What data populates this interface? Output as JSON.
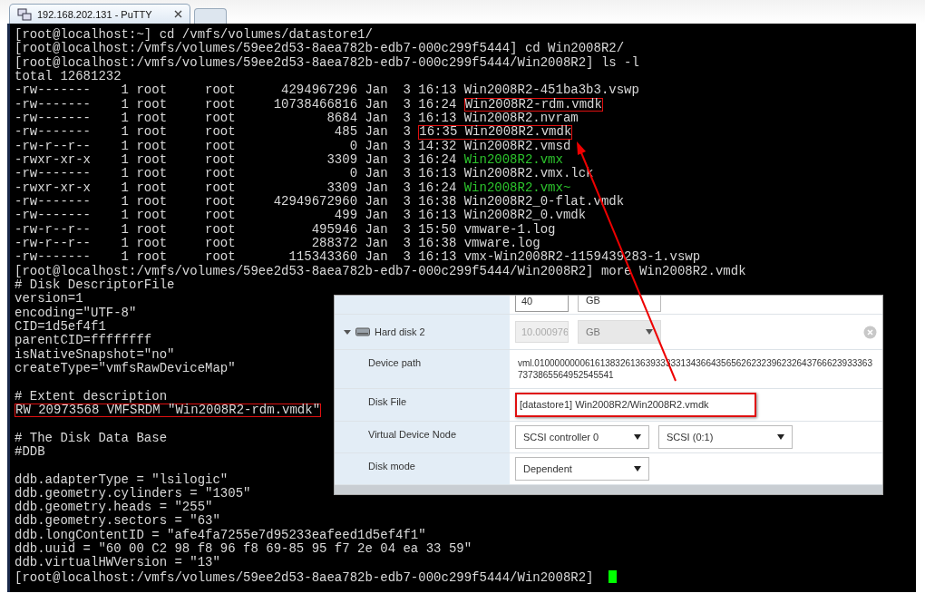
{
  "window": {
    "title": "192.168.202.131 - PuTTY"
  },
  "terminal": {
    "blocks": [
      {
        "lines": [
          {
            "parts": [
              {
                "text": "[root@localhost:~] cd /vmfs/volumes/datastore1/",
                "kind": "plain",
                "highlighted": false
              }
            ]
          },
          {
            "parts": [
              {
                "text": "[root@localhost:/vmfs/volumes/59ee2d53-8aea782b-edb7-000c299f5444] cd Win2008R2/",
                "kind": "plain",
                "highlighted": false
              }
            ]
          },
          {
            "parts": [
              {
                "text": "[root@localhost:/vmfs/volumes/59ee2d53-8aea782b-edb7-000c299f5444/Win2008R2] ls -l",
                "kind": "plain",
                "highlighted": false
              }
            ]
          },
          {
            "parts": [
              {
                "text": "total 12681232",
                "kind": "plain",
                "highlighted": false
              }
            ]
          },
          {
            "parts": [
              {
                "text": "-rw-------    1 root     root      4294967296 Jan  3 16:13 Win2008R2-451ba3b3.vswp",
                "kind": "plain",
                "highlighted": false
              }
            ]
          },
          {
            "parts": [
              {
                "text": "-rw-------    1 root     root     10738466816 Jan  3 16:24 ",
                "kind": "plain",
                "highlighted": false
              },
              {
                "text": "Win2008R2-rdm.vmdk",
                "kind": "plain",
                "highlighted": true
              }
            ]
          },
          {
            "parts": [
              {
                "text": "-rw-------    1 root     root            8684 Jan  3 16:13 Win2008R2.nvram",
                "kind": "plain",
                "highlighted": false
              }
            ]
          },
          {
            "parts": [
              {
                "text": "-rw-------    1 root     root             485 Jan  3 ",
                "kind": "plain",
                "highlighted": false
              },
              {
                "text": "16:35 Win2008R2.vmdk",
                "kind": "plain",
                "highlighted": true
              }
            ]
          },
          {
            "parts": [
              {
                "text": "-rw-r--r--    1 root     root               0 Jan  3 14:32 Win2008R2.vmsd",
                "kind": "plain",
                "highlighted": false
              }
            ]
          },
          {
            "parts": [
              {
                "text": "-rwxr-xr-x    1 root     root            3309 Jan  3 16:24 ",
                "kind": "plain",
                "highlighted": false
              },
              {
                "text": "Win2008R2.vmx",
                "kind": "executable",
                "highlighted": false
              }
            ]
          },
          {
            "parts": [
              {
                "text": "-rw-------    1 root     root               0 Jan  3 16:13 Win2008R2.vmx.lck",
                "kind": "plain",
                "highlighted": false
              }
            ]
          },
          {
            "parts": [
              {
                "text": "-rwxr-xr-x    1 root     root            3309 Jan  3 16:24 ",
                "kind": "plain",
                "highlighted": false
              },
              {
                "text": "Win2008R2.vmx~",
                "kind": "executable",
                "highlighted": false
              }
            ]
          },
          {
            "parts": [
              {
                "text": "-rw-------    1 root     root     42949672960 Jan  3 16:38 Win2008R2_0-flat.vmdk",
                "kind": "plain",
                "highlighted": false
              }
            ]
          },
          {
            "parts": [
              {
                "text": "-rw-------    1 root     root             499 Jan  3 16:13 Win2008R2_0.vmdk",
                "kind": "plain",
                "highlighted": false
              }
            ]
          },
          {
            "parts": [
              {
                "text": "-rw-r--r--    1 root     root          495946 Jan  3 15:50 vmware-1.log",
                "kind": "plain",
                "highlighted": false
              }
            ]
          },
          {
            "parts": [
              {
                "text": "-rw-r--r--    1 root     root          288372 Jan  3 16:38 vmware.log",
                "kind": "plain",
                "highlighted": false
              }
            ]
          },
          {
            "parts": [
              {
                "text": "-rw-------    1 root     root       115343360 Jan  3 16:13 vmx-Win2008R2-1159439283-1.vswp",
                "kind": "plain",
                "highlighted": false
              }
            ]
          },
          {
            "parts": [
              {
                "text": "[root@localhost:/vmfs/volumes/59ee2d53-8aea782b-edb7-000c299f5444/Win2008R2] more Win2008R2.vmdk",
                "kind": "plain",
                "highlighted": false
              }
            ]
          },
          {
            "parts": [
              {
                "text": "# Disk DescriptorFile",
                "kind": "plain",
                "highlighted": false
              }
            ]
          },
          {
            "parts": [
              {
                "text": "version=1",
                "kind": "plain",
                "highlighted": false
              }
            ]
          },
          {
            "parts": [
              {
                "text": "encoding=\"UTF-8\"",
                "kind": "plain",
                "highlighted": false
              }
            ]
          },
          {
            "parts": [
              {
                "text": "CID=1d5ef4f1",
                "kind": "plain",
                "highlighted": false
              }
            ]
          },
          {
            "parts": [
              {
                "text": "parentCID=ffffffff",
                "kind": "plain",
                "highlighted": false
              }
            ]
          },
          {
            "parts": [
              {
                "text": "isNativeSnapshot=\"no\"",
                "kind": "plain",
                "highlighted": false
              }
            ]
          },
          {
            "parts": [
              {
                "text": "createType=\"vmfsRawDeviceMap\"",
                "kind": "plain",
                "highlighted": false
              }
            ]
          }
        ]
      },
      {
        "lines": [
          {
            "parts": [
              {
                "text": "# Extent description",
                "kind": "plain",
                "highlighted": false
              }
            ]
          },
          {
            "parts": [
              {
                "text": "RW 20973568 VMFSRDM \"Win2008R2-rdm.vmdk\"",
                "kind": "plain",
                "highlighted": true
              }
            ]
          }
        ]
      },
      {
        "lines": [
          {
            "parts": [
              {
                "text": "# The Disk Data Base",
                "kind": "plain",
                "highlighted": false
              }
            ]
          },
          {
            "parts": [
              {
                "text": "#DDB",
                "kind": "plain",
                "highlighted": false
              }
            ]
          }
        ]
      },
      {
        "lines": [
          {
            "parts": [
              {
                "text": "ddb.adapterType = \"lsilogic\"",
                "kind": "plain",
                "highlighted": false
              }
            ]
          },
          {
            "parts": [
              {
                "text": "ddb.geometry.cylinders = \"1305\"",
                "kind": "plain",
                "highlighted": false
              }
            ]
          },
          {
            "parts": [
              {
                "text": "ddb.geometry.heads = \"255\"",
                "kind": "plain",
                "highlighted": false
              }
            ]
          },
          {
            "parts": [
              {
                "text": "ddb.geometry.sectors = \"63\"",
                "kind": "plain",
                "highlighted": false
              }
            ]
          },
          {
            "parts": [
              {
                "text": "ddb.longContentID = \"afe4fa7255e7d95233eafeed1d5ef4f1\"",
                "kind": "plain",
                "highlighted": false
              }
            ]
          },
          {
            "parts": [
              {
                "text": "ddb.uuid = \"60 00 C2 98 f8 96 f8 69-85 95 f7 2e 04 ea 33 59\"",
                "kind": "plain",
                "highlighted": false
              }
            ]
          },
          {
            "parts": [
              {
                "text": "ddb.virtualHWVersion = \"13\"",
                "kind": "plain",
                "highlighted": false
              }
            ]
          },
          {
            "parts": [
              {
                "text": "[root@localhost:/vmfs/volumes/59ee2d53-8aea782b-edb7-000c299f5444/Win2008R2] ",
                "kind": "plain",
                "highlighted": false
              }
            ]
          }
        ]
      }
    ]
  },
  "settings_panel": {
    "rows": [
      {
        "kind": "partial",
        "value": "40",
        "unit": "GB"
      },
      {
        "kind": "disk",
        "label": "Hard disk 2",
        "expanded": true,
        "disabled": true,
        "value": "10.000976",
        "unit": "GB"
      },
      {
        "kind": "text",
        "label": "Device path",
        "value": "vml.01000000006161383261363933333134366435656262323962326437666239333637373865564952545541",
        "highlighted": false
      },
      {
        "kind": "text",
        "label": "Disk File",
        "value": "[datastore1] Win2008R2/Win2008R2.vmdk",
        "highlighted": true
      },
      {
        "kind": "selects",
        "label": "Virtual Device Node",
        "values": [
          "SCSI controller 0",
          "SCSI (0:1)"
        ]
      },
      {
        "kind": "selects",
        "label": "Disk mode",
        "values": [
          "Dependent"
        ]
      }
    ]
  }
}
